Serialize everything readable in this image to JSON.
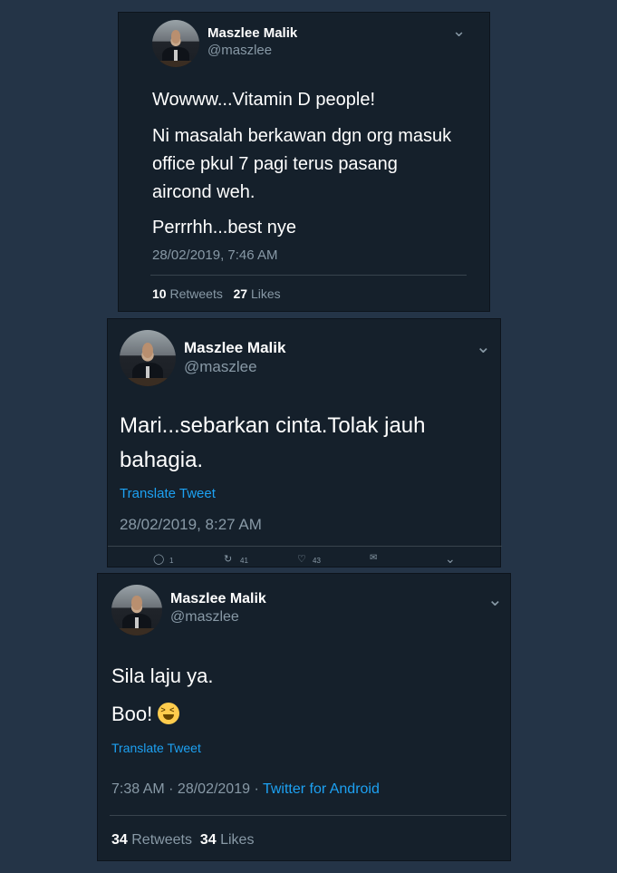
{
  "tweets": [
    {
      "name": "Maszlee Malik",
      "handle": "@maszlee",
      "chevron": "⌄",
      "lines": [
        "Wowww...Vitamin D people!",
        "Ni masalah berkawan dgn org masuk",
        "office pkul 7 pagi terus pasang",
        "aircond weh.",
        "Perrrhh...best nye"
      ],
      "timestamp": "28/02/2019, 7:46 AM",
      "retweets": "10",
      "retweets_label": "Retweets",
      "likes": "27",
      "likes_label": "Likes"
    },
    {
      "name": "Maszlee Malik",
      "handle": "@maszlee",
      "chevron": "⌄",
      "lines": [
        "Mari...sebarkan cinta.Tolak jauh",
        "bahagia."
      ],
      "translate": "Translate Tweet",
      "timestamp": "28/02/2019, 8:27 AM",
      "actions": {
        "reply_icon": "reply-icon",
        "reply_count": "1",
        "retweet_icon": "retweet-icon",
        "retweet_count": "41",
        "like_icon": "heart-icon",
        "like_count": "43",
        "message_icon": "envelope-icon",
        "more_icon": "chevron-down-icon"
      }
    },
    {
      "name": "Maszlee Malik",
      "handle": "@maszlee",
      "chevron": "⌄",
      "lines": [
        "Sila laju ya.",
        "Boo!"
      ],
      "emoji": "laughing-face-emoji",
      "translate": "Translate Tweet",
      "timestamp": "7:38 AM · 28/02/2019 · ",
      "source": "Twitter for Android",
      "retweets": "34",
      "retweets_label": "Retweets",
      "likes": "34",
      "likes_label": "Likes"
    }
  ],
  "colors": {
    "background": "#243447",
    "card": "#15202b",
    "secondary_text": "#8899a6",
    "link": "#1da1f2"
  }
}
